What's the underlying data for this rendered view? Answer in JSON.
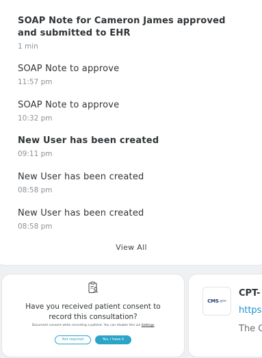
{
  "notifications": {
    "items": [
      {
        "title": "SOAP Note for Cameron James approved and submitted to EHR",
        "time": "1 min",
        "bold": true
      },
      {
        "title": "SOAP Note to approve",
        "time": "11:57 pm",
        "bold": false
      },
      {
        "title": "SOAP Note to approve",
        "time": "10:32 pm",
        "bold": false
      },
      {
        "title": "New User has been created",
        "time": "09:11 pm",
        "bold": true
      },
      {
        "title": "New User has been created",
        "time": "08:58 pm",
        "bold": false
      },
      {
        "title": "New User has been created",
        "time": "08:58 pm",
        "bold": false
      }
    ],
    "view_all_label": "View All"
  },
  "consent": {
    "icon": "clipboard-user-icon",
    "question": "Have you received patient consent to record this consultation?",
    "note": "Document consent while recording a patient. You can disable this via ",
    "settings_link": "Settings",
    "not_required_label": "Not required",
    "yes_label": "Yes, I have it"
  },
  "link_preview": {
    "logo_text": "CMS",
    "logo_suffix": ".gov",
    "title": "CPT-",
    "url": "https",
    "description": "The C"
  },
  "colors": {
    "accent": "#2aa4c7",
    "link": "#1d8fd0",
    "background": "#eef0f2"
  }
}
